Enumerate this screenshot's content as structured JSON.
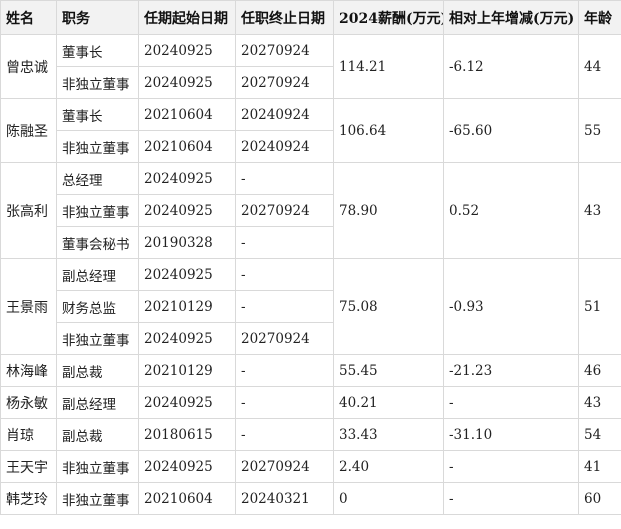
{
  "headers": [
    "姓名",
    "职务",
    "任期起始日期",
    "任职终止日期",
    "2024薪酬(万元)",
    "相对上年增减(万元)",
    "年龄"
  ],
  "people": [
    {
      "name": "曾忠诚",
      "salary": "114.21",
      "change": "-6.12",
      "age": "44",
      "roles": [
        {
          "title": "董事长",
          "start": "20240925",
          "end": "20270924"
        },
        {
          "title": "非独立董事",
          "start": "20240925",
          "end": "20270924"
        }
      ]
    },
    {
      "name": "陈融圣",
      "salary": "106.64",
      "change": "-65.60",
      "age": "55",
      "roles": [
        {
          "title": "董事长",
          "start": "20210604",
          "end": "20240924"
        },
        {
          "title": "非独立董事",
          "start": "20210604",
          "end": "20240924"
        }
      ]
    },
    {
      "name": "张高利",
      "salary": "78.90",
      "change": "0.52",
      "age": "43",
      "roles": [
        {
          "title": "总经理",
          "start": "20240925",
          "end": "-"
        },
        {
          "title": "非独立董事",
          "start": "20240925",
          "end": "20270924"
        },
        {
          "title": "董事会秘书",
          "start": "20190328",
          "end": "-"
        }
      ]
    },
    {
      "name": "王景雨",
      "salary": "75.08",
      "change": "-0.93",
      "age": "51",
      "roles": [
        {
          "title": "副总经理",
          "start": "20240925",
          "end": "-"
        },
        {
          "title": "财务总监",
          "start": "20210129",
          "end": "-"
        },
        {
          "title": "非独立董事",
          "start": "20240925",
          "end": "20270924"
        }
      ]
    },
    {
      "name": "林海峰",
      "salary": "55.45",
      "change": "-21.23",
      "age": "46",
      "roles": [
        {
          "title": "副总裁",
          "start": "20210129",
          "end": "-"
        }
      ]
    },
    {
      "name": "杨永敏",
      "salary": "40.21",
      "change": "-",
      "age": "43",
      "roles": [
        {
          "title": "副总经理",
          "start": "20240925",
          "end": "-"
        }
      ]
    },
    {
      "name": "肖琼",
      "salary": "33.43",
      "change": "-31.10",
      "age": "54",
      "roles": [
        {
          "title": "副总裁",
          "start": "20180615",
          "end": "-"
        }
      ]
    },
    {
      "name": "王天宇",
      "salary": "2.40",
      "change": "-",
      "age": "41",
      "roles": [
        {
          "title": "非独立董事",
          "start": "20240925",
          "end": "20270924"
        }
      ]
    },
    {
      "name": "韩芝玲",
      "salary": "0",
      "change": "-",
      "age": "60",
      "roles": [
        {
          "title": "非独立董事",
          "start": "20210604",
          "end": "20240321"
        }
      ]
    }
  ]
}
